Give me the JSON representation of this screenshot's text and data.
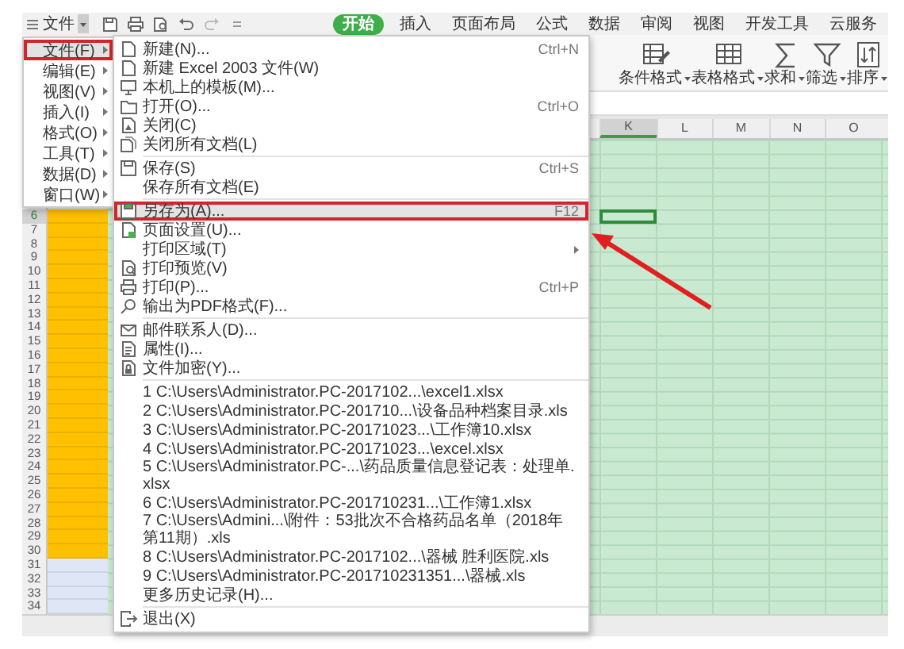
{
  "title_bar": {
    "file_button": "文件",
    "tabs": [
      {
        "label": "开始",
        "selected": true
      },
      {
        "label": "插入",
        "selected": false
      },
      {
        "label": "页面布局",
        "selected": false
      },
      {
        "label": "公式",
        "selected": false
      },
      {
        "label": "数据",
        "selected": false
      },
      {
        "label": "审阅",
        "selected": false
      },
      {
        "label": "视图",
        "selected": false
      },
      {
        "label": "开发工具",
        "selected": false
      },
      {
        "label": "云服务",
        "selected": false
      }
    ]
  },
  "ribbon": {
    "buttons": [
      {
        "label": "条件格式"
      },
      {
        "label": "表格格式"
      },
      {
        "label": "求和"
      },
      {
        "label": "筛选"
      },
      {
        "label": "排序"
      }
    ]
  },
  "sheet": {
    "columns": [
      {
        "label": "K",
        "selected": true
      },
      {
        "label": "L",
        "selected": false
      },
      {
        "label": "M",
        "selected": false
      },
      {
        "label": "N",
        "selected": false
      },
      {
        "label": "O",
        "selected": false
      }
    ],
    "rows": [
      {
        "label": "6",
        "selected": true,
        "color": "#ffc000"
      },
      {
        "label": "7",
        "selected": false,
        "color": "#ffc000"
      },
      {
        "label": "8",
        "selected": false,
        "color": "#ffc000"
      },
      {
        "label": "9",
        "selected": false,
        "color": "#ffc000"
      },
      {
        "label": "10",
        "selected": false,
        "color": "#ffc000"
      },
      {
        "label": "11",
        "selected": false,
        "color": "#ffc000"
      },
      {
        "label": "12",
        "selected": false,
        "color": "#ffc000"
      },
      {
        "label": "13",
        "selected": false,
        "color": "#ffc000"
      },
      {
        "label": "14",
        "selected": false,
        "color": "#ffc000"
      },
      {
        "label": "15",
        "selected": false,
        "color": "#ffc000"
      },
      {
        "label": "16",
        "selected": false,
        "color": "#ffc000"
      },
      {
        "label": "17",
        "selected": false,
        "color": "#ffc000"
      },
      {
        "label": "18",
        "selected": false,
        "color": "#ffc000"
      },
      {
        "label": "19",
        "selected": false,
        "color": "#ffc000"
      },
      {
        "label": "20",
        "selected": false,
        "color": "#ffc000"
      },
      {
        "label": "21",
        "selected": false,
        "color": "#ffc000"
      },
      {
        "label": "22",
        "selected": false,
        "color": "#ffc000"
      },
      {
        "label": "23",
        "selected": false,
        "color": "#ffc000"
      },
      {
        "label": "24",
        "selected": false,
        "color": "#ffc000"
      },
      {
        "label": "25",
        "selected": false,
        "color": "#ffc000"
      },
      {
        "label": "26",
        "selected": false,
        "color": "#ffc000"
      },
      {
        "label": "27",
        "selected": false,
        "color": "#ffc000"
      },
      {
        "label": "28",
        "selected": false,
        "color": "#ffc000"
      },
      {
        "label": "29",
        "selected": false,
        "color": "#ffc000"
      },
      {
        "label": "30",
        "selected": false,
        "color": "#ffc000"
      },
      {
        "label": "31",
        "selected": false,
        "color": "#dfe6f5"
      },
      {
        "label": "32",
        "selected": false,
        "color": "#dfe6f5"
      },
      {
        "label": "33",
        "selected": false,
        "color": "#dfe6f5"
      },
      {
        "label": "34",
        "selected": false,
        "color": "#dfe6f5"
      }
    ]
  },
  "file_menu": {
    "items": [
      {
        "label": "文件(F)",
        "selected": true,
        "highlighted": true,
        "has_submenu": true
      },
      {
        "label": "编辑(E)",
        "selected": false,
        "highlighted": false,
        "has_submenu": true
      },
      {
        "label": "视图(V)",
        "selected": false,
        "highlighted": false,
        "has_submenu": true
      },
      {
        "label": "插入(I)",
        "selected": false,
        "highlighted": false,
        "has_submenu": true
      },
      {
        "label": "格式(O)",
        "selected": false,
        "highlighted": false,
        "has_submenu": true
      },
      {
        "label": "工具(T)",
        "selected": false,
        "highlighted": false,
        "has_submenu": true
      },
      {
        "label": "数据(D)",
        "selected": false,
        "highlighted": false,
        "has_submenu": true
      },
      {
        "label": "窗口(W)",
        "selected": false,
        "highlighted": false,
        "has_submenu": true
      }
    ]
  },
  "submenu": {
    "items": [
      {
        "kind": "command",
        "label": "新建(N)...",
        "shortcut": "Ctrl+N",
        "selected": false,
        "highlighted": false,
        "has_submenu": false
      },
      {
        "kind": "command",
        "label": "新建 Excel 2003 文件(W)",
        "selected": false,
        "highlighted": false,
        "has_submenu": false
      },
      {
        "kind": "command",
        "label": "本机上的模板(M)...",
        "selected": false,
        "highlighted": false,
        "has_submenu": false
      },
      {
        "kind": "command",
        "label": "打开(O)...",
        "shortcut": "Ctrl+O",
        "selected": false,
        "highlighted": false,
        "has_submenu": false
      },
      {
        "kind": "command",
        "label": "关闭(C)",
        "selected": false,
        "highlighted": false,
        "has_submenu": false
      },
      {
        "kind": "command",
        "label": "关闭所有文档(L)",
        "selected": false,
        "highlighted": false,
        "has_submenu": false
      },
      {
        "kind": "separator"
      },
      {
        "kind": "command",
        "label": "保存(S)",
        "shortcut": "Ctrl+S",
        "selected": false,
        "highlighted": false,
        "has_submenu": false
      },
      {
        "kind": "command",
        "label": "保存所有文档(E)",
        "selected": false,
        "highlighted": false,
        "has_submenu": false
      },
      {
        "kind": "separator"
      },
      {
        "kind": "command",
        "label": "另存为(A)...",
        "shortcut": "F12",
        "selected": true,
        "highlighted": true,
        "has_submenu": false
      },
      {
        "kind": "command",
        "label": "页面设置(U)...",
        "selected": false,
        "highlighted": false,
        "has_submenu": false
      },
      {
        "kind": "command",
        "label": "打印区域(T)",
        "selected": false,
        "highlighted": false,
        "has_submenu": true
      },
      {
        "kind": "command",
        "label": "打印预览(V)",
        "selected": false,
        "highlighted": false,
        "has_submenu": false
      },
      {
        "kind": "command",
        "label": "打印(P)...",
        "shortcut": "Ctrl+P",
        "selected": false,
        "highlighted": false,
        "has_submenu": false
      },
      {
        "kind": "command",
        "label": "输出为PDF格式(F)...",
        "selected": false,
        "highlighted": false,
        "has_submenu": false
      },
      {
        "kind": "separator"
      },
      {
        "kind": "command",
        "label": "邮件联系人(D)...",
        "selected": false,
        "highlighted": false,
        "has_submenu": false
      },
      {
        "kind": "command",
        "label": "属性(I)...",
        "selected": false,
        "highlighted": false,
        "has_submenu": false
      },
      {
        "kind": "command",
        "label": "文件加密(Y)...",
        "selected": false,
        "highlighted": false,
        "has_submenu": false
      },
      {
        "kind": "separator"
      },
      {
        "kind": "recent",
        "label": "1 C:\\Users\\Administrator.PC-2017102...\\excel1.xlsx"
      },
      {
        "kind": "recent",
        "label": "2 C:\\Users\\Administrator.PC-201710...\\设备品种档案目录.xls"
      },
      {
        "kind": "recent",
        "label": "3 C:\\Users\\Administrator.PC-20171023...\\工作簿10.xlsx"
      },
      {
        "kind": "recent",
        "label": "4 C:\\Users\\Administrator.PC-20171023...\\excel.xlsx"
      },
      {
        "kind": "recent",
        "label": "5 C:\\Users\\Administrator.PC-...\\药品质量信息登记表：处理单.xlsx"
      },
      {
        "kind": "recent",
        "label": "6 C:\\Users\\Administrator.PC-201710231...\\工作簿1.xlsx"
      },
      {
        "kind": "recent",
        "label": "7 C:\\Users\\Admini...\\附件：53批次不合格药品名单（2018年第11期）.xls"
      },
      {
        "kind": "recent",
        "label": "8 C:\\Users\\Administrator.PC-2017102...\\器械 胜利医院.xls"
      },
      {
        "kind": "recent",
        "label": "9 C:\\Users\\Administrator.PC-201710231351...\\器械.xls"
      },
      {
        "kind": "recent",
        "label": "更多历史记录(H)..."
      },
      {
        "kind": "separator"
      },
      {
        "kind": "command",
        "label": "退出(X)",
        "selected": false,
        "highlighted": false,
        "has_submenu": false
      }
    ]
  }
}
